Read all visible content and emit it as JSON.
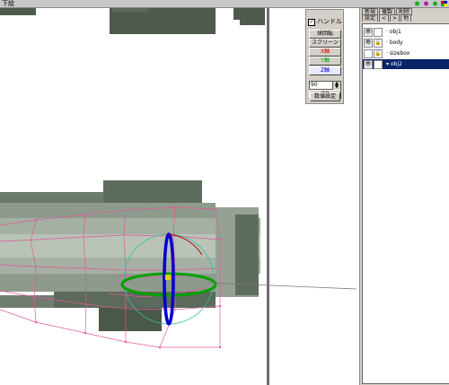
{
  "titlebar": {
    "label": "下絵"
  },
  "tool_panel": {
    "title": "",
    "handle_label": "ハンドル",
    "handle_checked": true,
    "buttons": [
      "球回転",
      "スクリーン",
      "X軸",
      "Y軸",
      "Z軸"
    ],
    "axis_colors": {
      "x": "#d40000",
      "y": "#00a000",
      "z": "#0000d0"
    },
    "input_value": "90",
    "ok_label": "OK",
    "numeric_label": "数値設定"
  },
  "object_panel": {
    "tabs_row1": [
      "新規",
      "複製",
      "削除"
    ],
    "tabs_row2": [
      "設定",
      "<",
      ">",
      "他"
    ],
    "objects": [
      {
        "name": "obj1",
        "visible": true,
        "locked": false,
        "selected": false
      },
      {
        "name": "body",
        "visible": true,
        "locked": true,
        "selected": false
      },
      {
        "name": "sizebox",
        "visible": false,
        "locked": true,
        "selected": false
      },
      {
        "name": "obj2",
        "visible": true,
        "locked": false,
        "selected": true
      }
    ]
  }
}
